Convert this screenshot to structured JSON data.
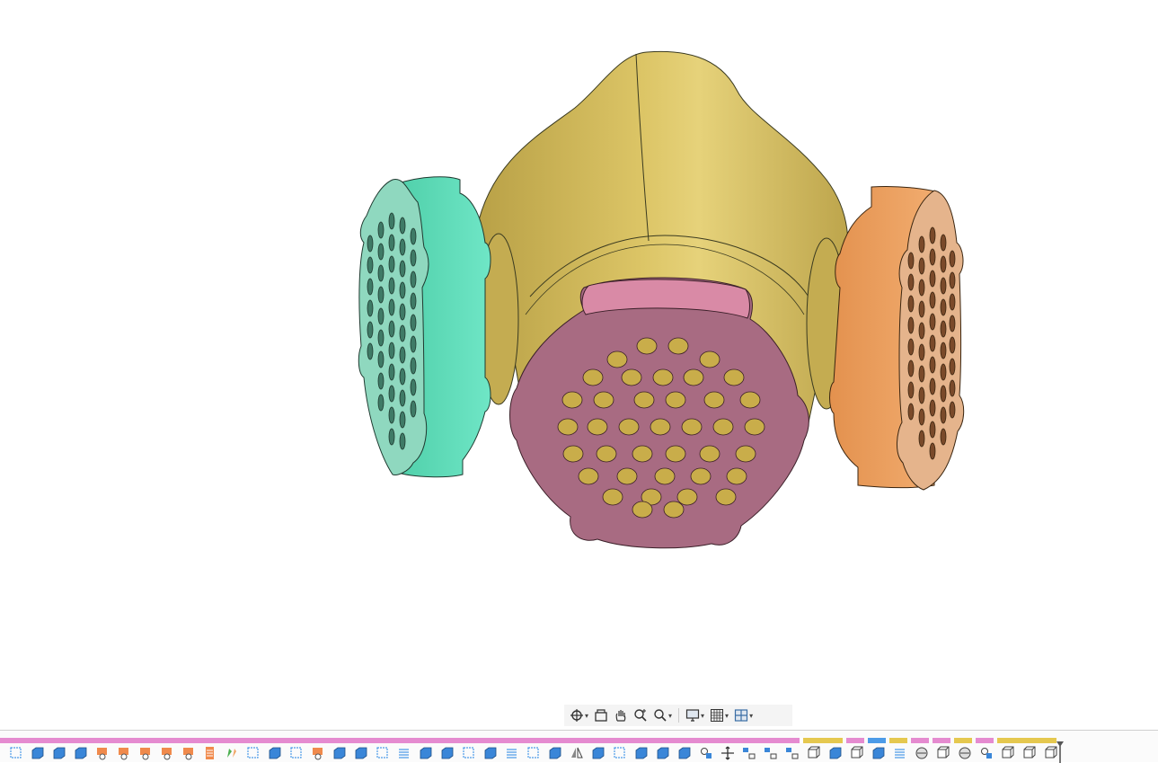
{
  "viewport": {
    "background": "#ffffff",
    "model": {
      "mask_body_color": "#d6be5e",
      "mask_body_shadow": "#b7a048",
      "left_cartridge_color": "#63e0bd",
      "left_cartridge_face": "#8fd8bf",
      "right_cartridge_color": "#f0a463",
      "right_cartridge_face": "#e5b48c",
      "front_valve_color": "#d98aa6",
      "front_valve_face": "#a86b82",
      "hole_color": "#c9ad4a"
    }
  },
  "nav_toolbar": {
    "items": [
      {
        "icon": "orbit-icon",
        "has_dropdown": true
      },
      {
        "icon": "look-at-icon",
        "has_dropdown": false
      },
      {
        "icon": "pan-icon",
        "has_dropdown": false
      },
      {
        "icon": "zoom-icon",
        "has_dropdown": false
      },
      {
        "icon": "fit-icon",
        "has_dropdown": true
      },
      {
        "icon": "display-settings-icon",
        "has_dropdown": true
      },
      {
        "icon": "grid-settings-icon",
        "has_dropdown": true
      },
      {
        "icon": "viewports-icon",
        "has_dropdown": true
      }
    ]
  },
  "timeline": {
    "bar_segments": [
      {
        "color": "#e58bd0",
        "from": 0,
        "to": 890
      },
      {
        "color": "#ffffff",
        "from": 890,
        "to": 894
      },
      {
        "color": "#e5c84f",
        "from": 894,
        "to": 938
      },
      {
        "color": "#e58bd0",
        "from": 942,
        "to": 962
      },
      {
        "color": "#4c9be8",
        "from": 966,
        "to": 986
      },
      {
        "color": "#e5c84f",
        "from": 990,
        "to": 1010
      },
      {
        "color": "#e58bd0",
        "from": 1014,
        "to": 1034
      },
      {
        "color": "#e58bd0",
        "from": 1038,
        "to": 1058
      },
      {
        "color": "#e5c84f",
        "from": 1062,
        "to": 1082
      },
      {
        "color": "#e58bd0",
        "from": 1086,
        "to": 1106
      },
      {
        "color": "#e5c84f",
        "from": 1110,
        "to": 1176
      }
    ],
    "features": [
      "sketch-icon",
      "extrude-icon",
      "plane-icon",
      "plane-icon",
      "revolve-icon",
      "revolve-icon",
      "hole-icon",
      "revolve-icon",
      "revolve-icon",
      "pattern-icon",
      "loft-icon",
      "sketch-icon",
      "extrude-icon",
      "sketch-icon",
      "revolve-icon",
      "extrude-icon",
      "extrude-icon",
      "sketch-icon",
      "thread-icon",
      "extrude-icon",
      "extrude-icon",
      "sketch-icon",
      "extrude-icon",
      "thread-icon",
      "sketch-icon",
      "extrude-icon",
      "mirror-icon",
      "extrude-icon",
      "sketch-icon",
      "extrude-icon",
      "extrude-icon",
      "extrude-icon",
      "joint-icon",
      "move-icon",
      "align-icon",
      "align-icon",
      "align-icon",
      "box-icon",
      "combine-icon",
      "box-icon",
      "combine-icon",
      "thread-icon",
      "split-icon",
      "box-icon",
      "split-icon",
      "joint-icon",
      "shell-icon",
      "shell-icon",
      "shell-icon"
    ]
  }
}
